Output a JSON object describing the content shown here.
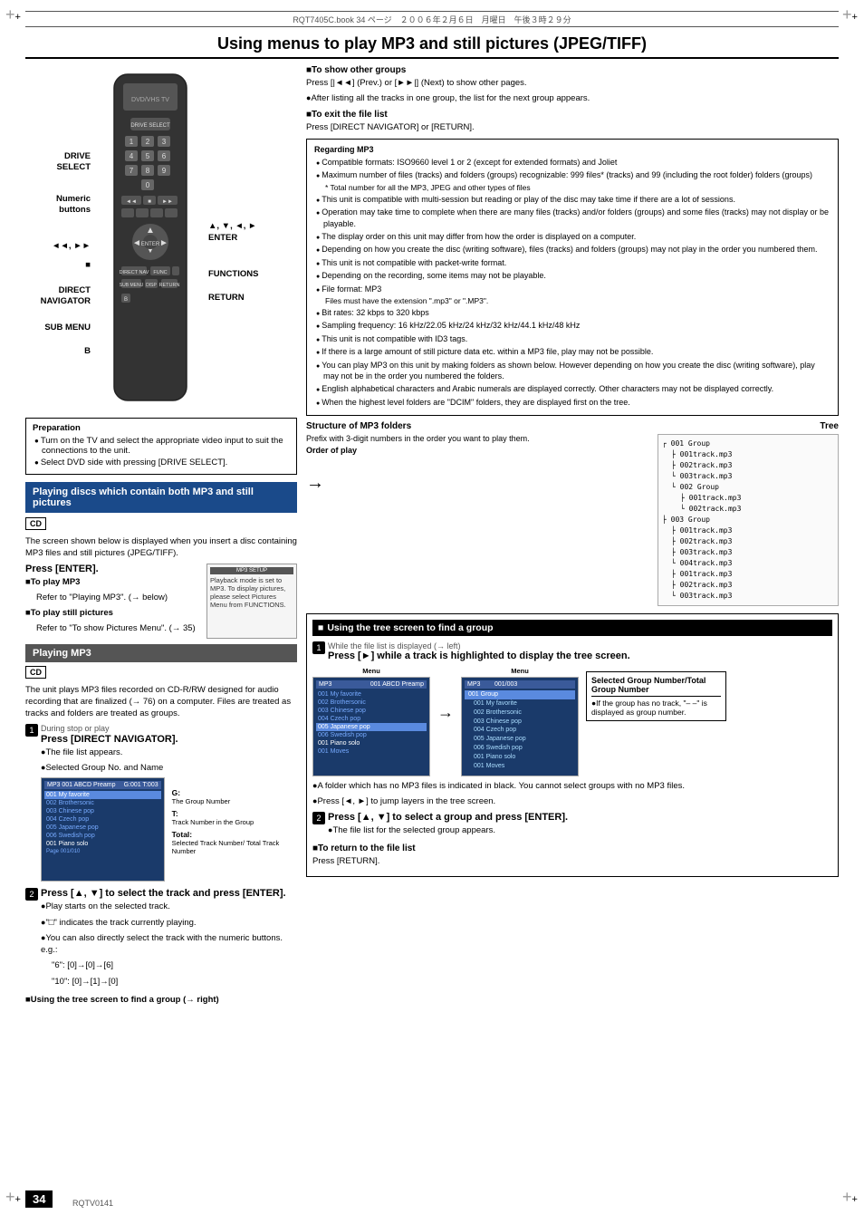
{
  "page": {
    "header_text": "RQT7405C.book 34 ページ　２００６年２月６日　月曜日　午後３時２９分",
    "main_title": "Using menus to play MP3 and still pictures (JPEG/TIFF)",
    "page_number": "34",
    "doc_code": "RQTV0141"
  },
  "left_column": {
    "remote_labels": {
      "drive_select": "DRIVE\nSELECT",
      "numeric_buttons": "Numeric\nbuttons",
      "arrows": "◄◄, ►►",
      "square": "■",
      "direct_navigator": "DIRECT\nNAVIGATOR",
      "sub_menu": "SUB MENU",
      "b": "B",
      "enter": "▲, ▼, ◄, ►\nENTER",
      "functions": "FUNCTIONS",
      "return": "RETURN"
    },
    "preparation": {
      "title": "Preparation",
      "items": [
        "Turn on the TV and select the appropriate video input to suit the connections to the unit.",
        "Select DVD side with pressing [DRIVE SELECT]."
      ]
    },
    "playing_discs_section": {
      "title": "Playing discs which contain both MP3 and still pictures",
      "cd_label": "CD",
      "body": "The screen shown below is displayed when you insert a disc containing MP3 files and still pictures (JPEG/TIFF).",
      "press_enter": "Press [ENTER].",
      "to_play_mp3_title": "■To play MP3",
      "to_play_mp3_body": "Refer to \"Playing MP3\". (→ below)",
      "to_play_still_title": "■To play still pictures",
      "to_play_still_body": "Refer to \"To show Pictures Menu\". (→ 35)",
      "small_screen_text": "Playback mode is set to MP3. To display pictures, please select Pictures Menu from FUNCTIONS."
    },
    "playing_mp3": {
      "title": "Playing MP3",
      "cd_label": "CD",
      "body": "The unit plays MP3 files recorded on CD-R/RW designed for audio recording that are finalized (→ 76) on a computer. Files are treated as tracks and folders are treated as groups.",
      "step1": {
        "label": "1",
        "during": "During stop or play",
        "press": "Press [DIRECT NAVIGATOR].",
        "note1": "The file list appears.",
        "note2": "Selected Group No. and Name",
        "group_labels": {
          "g": "G:",
          "g_desc": "The Group Number",
          "t": "T:",
          "t_desc": "Track Number in the Group",
          "total": "Total:",
          "total_desc": "Selected Track Number/ Total Track Number"
        }
      },
      "step2": {
        "label": "2",
        "press": "Press [▲, ▼] to select the track and press [ENTER].",
        "notes": [
          "Play starts on the selected track.",
          "\"□\" indicates the track currently playing.",
          "You can also directly select the track with the numeric buttons. e.g.:",
          "\"6\": [0]→[0]→[6]",
          "\"10\": [0]→[1]→[0]"
        ]
      },
      "using_tree": "■Using the tree screen to find a group (→ right)"
    }
  },
  "right_column": {
    "to_show_groups": {
      "title": "■To show other groups",
      "body": "Press [|◄◄] (Prev.) or [►►|] (Next) to show other pages.",
      "note": "After listing all the tracks in one group, the list for the next group appears."
    },
    "to_exit": {
      "title": "■To exit the file list",
      "body": "Press [DIRECT NAVIGATOR] or [RETURN]."
    },
    "regarding_mp3": {
      "title": "Regarding MP3",
      "items": [
        "Compatible formats: ISO9660 level 1 or 2 (except for extended formats) and Joliet",
        "Maximum number of files (tracks) and folders (groups) recognizable: 999 files* (tracks) and 99 (including the root folder) folders (groups)",
        "* Total number for all the MP3, JPEG and other types of files",
        "This unit is compatible with multi-session but reading or play of the disc may take time if there are a lot of sessions.",
        "Operation may take time to complete when there are many files (tracks) and/or folders (groups) and some files (tracks) may not display or be playable.",
        "The display order on this unit may differ from how the order is displayed on a computer.",
        "Depending on how you create the disc (writing software), files (tracks) and folders (groups) may not play in the order you numbered them.",
        "This unit is not compatible with packet-write format.",
        "Depending on the recording, some items may not be playable.",
        "File format: MP3",
        "Files must have the extension \".mp3\" or \".MP3\".",
        "Bit rates: 32 kbps to 320 kbps",
        "Sampling frequency: 16 kHz/22.05 kHz/24 kHz/32 kHz/44.1 kHz/48 kHz",
        "This unit is not compatible with ID3 tags.",
        "If there is a large amount of still picture data etc. within a MP3 file, play may not be possible.",
        "You can play MP3 on this unit by making folders as shown below. However depending on how you create the disc (writing software), play may not be in the order you numbered the folders.",
        "English alphabetical characters and Arabic numerals are displayed correctly. Other characters may not be displayed correctly.",
        "When the highest level folders are \"DCIM\" folders, they are displayed first on the tree."
      ]
    },
    "mp3_structure": {
      "title": "Structure of MP3 folders",
      "body": "Prefix with 3-digit numbers in the order you want to play them.",
      "tree_label": "Tree",
      "order_label": "Order of play",
      "tree_items": [
        "001 Group",
        "  001track.mp3",
        "  002track.mp3",
        "  003track.mp3",
        "  002 Group",
        "   001track.mp3",
        "   002track.mp3",
        "003 Group",
        "  001track.mp3",
        "  002track.mp3",
        "  003track.mp3",
        "  004track.mp3",
        "  001track.mp3",
        "  002track.mp3",
        "  003track.mp3"
      ]
    },
    "using_tree_section": {
      "title": "■  Using the tree screen to find a group",
      "step1": {
        "label": "1",
        "condition": "While the file list is displayed (→ left)",
        "press": "Press [►] while a track is highlighted to display the tree screen."
      },
      "selected_group_box": {
        "title": "Selected Group Number/Total Group Number",
        "note": "●If the group has no track, \"– –\" is displayed as group number."
      },
      "notes": [
        "A folder which has no MP3 files is indicated in black. You cannot select groups with no MP3 files.",
        "Press [◄, ►] to jump layers in the tree screen."
      ],
      "step2": {
        "label": "2",
        "press": "Press [▲, ▼] to select a group and press [ENTER].",
        "note": "The file list for the selected group appears."
      },
      "to_return": {
        "title": "■To return to the file list",
        "body": "Press [RETURN]."
      },
      "nav_screen": {
        "header": "MP3  001 ABCD Preamp",
        "rows": [
          "001 My favorite",
          "002 Brothersonic",
          "003 Chinese pop",
          "004 Czech pop",
          "005 Japanese pop",
          "006 Swedish pop",
          "001 Piano solo",
          "001 Moves"
        ]
      },
      "tree_screen": {
        "header": "MP3",
        "rows": [
          "001 Group",
          " 001 My favorite",
          " 002 Brothersonic",
          " 003 Chinese pop",
          " 004 Czech pop",
          " 005 Japanese pop",
          " 006 Swedish pop",
          " 001 Piano solo",
          " 001 Moves"
        ]
      }
    }
  }
}
